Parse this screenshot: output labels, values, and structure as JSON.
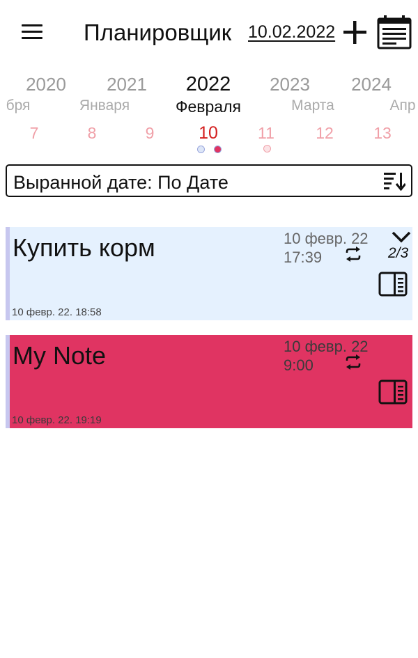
{
  "header": {
    "title": "Планировщик",
    "date": "10.02.2022"
  },
  "picker": {
    "years": [
      "2020",
      "2021",
      "2022",
      "2023",
      "2024"
    ],
    "months": [
      "бря",
      "Января",
      "Февраля",
      "Марта",
      "Апр"
    ],
    "days": [
      "7",
      "8",
      "9",
      "10",
      "11",
      "12",
      "13"
    ]
  },
  "sort": {
    "label": "Выранной дате: По Дате"
  },
  "notes": [
    {
      "title": "Купить корм",
      "date": "10 февр. 22",
      "time": "17:39",
      "pages": "2/3",
      "created": "10 февр. 22. 18:58",
      "color": "#e5f1fe"
    },
    {
      "title": "My Note",
      "date": "10 февр. 22",
      "time": "9:00",
      "created": "10 февр. 22. 19:19",
      "color": "#e03462"
    }
  ],
  "colors": {
    "accent_selected_day": "#d42020",
    "day_inactive": "#f0a0a8",
    "note_stripe": "#c7c7ef"
  }
}
